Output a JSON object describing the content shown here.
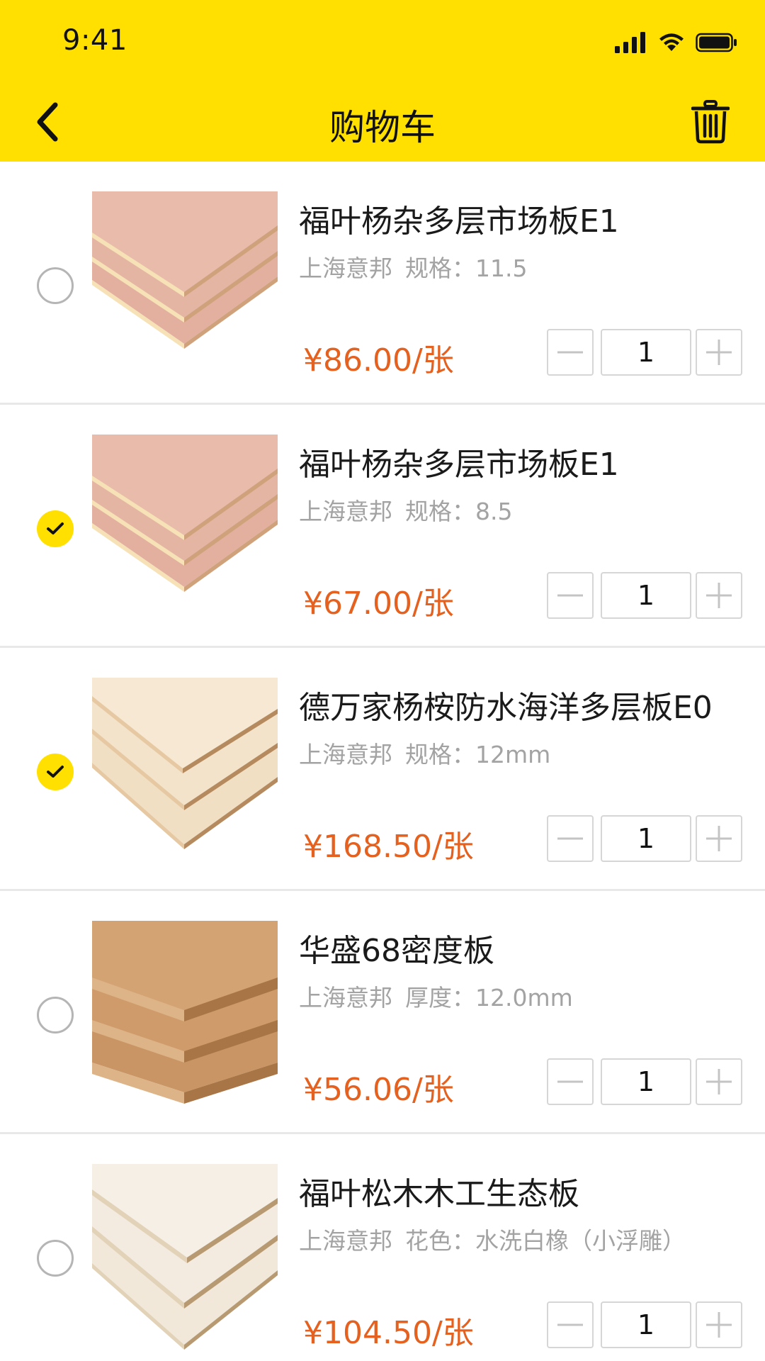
{
  "status_bar": {
    "time": "9:41"
  },
  "header": {
    "title": "购物车"
  },
  "cart": {
    "items": [
      {
        "name": "福叶杨杂多层市场板E1",
        "brand": "上海意邦",
        "spec": "规格：11.5",
        "price": "¥86.00/张",
        "quantity": "1",
        "checked": false,
        "thumb": "pink"
      },
      {
        "name": "福叶杨杂多层市场板E1",
        "brand": "上海意邦",
        "spec": "规格：8.5",
        "price": "¥67.00/张",
        "quantity": "1",
        "checked": true,
        "thumb": "pink"
      },
      {
        "name": "德万家杨桉防水海洋多层板E0",
        "brand": "上海意邦",
        "spec": "规格：12mm",
        "price": "¥168.50/张",
        "quantity": "1",
        "checked": true,
        "thumb": "light"
      },
      {
        "name": "华盛68密度板",
        "brand": "上海意邦",
        "spec": "厚度：12.0mm",
        "price": "¥56.06/张",
        "quantity": "1",
        "checked": false,
        "thumb": "mdf"
      },
      {
        "name": "福叶松木木工生态板",
        "brand": "上海意邦",
        "spec": "花色：水洗白橡（小浮雕）",
        "price": "¥104.50/张",
        "quantity": "1",
        "checked": false,
        "thumb": "white"
      }
    ]
  },
  "colors": {
    "header_bg": "#FFE000",
    "price": "#E4611F",
    "check_fill": "#FFE000",
    "muted_text": "#A3A3A3",
    "divider": "#E8E8E8"
  },
  "icons": {
    "back": "chevron-left-icon",
    "delete": "trash-icon",
    "check": "check-icon",
    "minus": "minus-icon",
    "plus": "plus-icon"
  }
}
